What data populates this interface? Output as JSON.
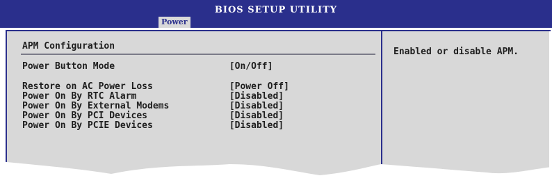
{
  "header": {
    "title": "BIOS SETUP UTILITY",
    "active_tab": "Power"
  },
  "menu": {
    "section_title": "APM Configuration",
    "items": [
      {
        "label": "Power Button Mode",
        "value": "[On/Off]"
      },
      {
        "label": "Restore on AC Power Loss",
        "value": "[Power Off]"
      },
      {
        "label": "Power On By RTC Alarm",
        "value": "[Disabled]"
      },
      {
        "label": "Power On By External Modems",
        "value": "[Disabled]"
      },
      {
        "label": "Power On By PCI Devices",
        "value": "[Disabled]"
      },
      {
        "label": "Power On By PCIE Devices",
        "value": "[Disabled]"
      }
    ]
  },
  "help": {
    "text": "Enabled or disable APM."
  },
  "colors": {
    "header_bg": "#2a2f8c",
    "panel_bg": "#d8d8d8",
    "text": "#1e1e1e",
    "tab_bg": "#d9d9d9"
  }
}
